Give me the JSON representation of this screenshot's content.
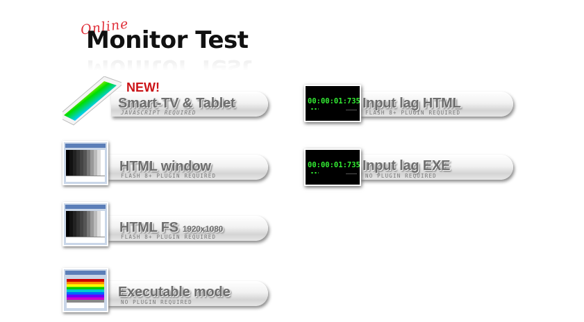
{
  "logo": {
    "online": "Online",
    "title": "Monitor Test"
  },
  "new_badge": "NEW!",
  "items": [
    {
      "id": "smart-tv",
      "label": "Smart-TV & Tablet",
      "sub": "JAVASCRIPT REQUIRED",
      "thumb": "tablet-rainbow"
    },
    {
      "id": "html-window",
      "label": "HTML window",
      "sub": "FLASH 8+ PLUGIN REQUIRED",
      "thumb": "grayscale-window"
    },
    {
      "id": "html-fs",
      "label": "HTML FS",
      "label_small": "1920x1080",
      "sub": "FLASH 8+ PLUGIN REQUIRED",
      "thumb": "grayscale-window"
    },
    {
      "id": "executable",
      "label": "Executable mode",
      "sub": "NO PLUGIN REQUIRED",
      "thumb": "rainbow-window"
    },
    {
      "id": "input-lag-html",
      "label": "Input lag HTML",
      "sub": "FLASH 8+ PLUGIN REQUIRED",
      "timer": "00:00:01:735"
    },
    {
      "id": "input-lag-exe",
      "label": "Input lag EXE",
      "sub": "NO PLUGIN REQUIRED",
      "timer": "00:00:01:735"
    }
  ],
  "colors": {
    "accent_red": "#cc1418",
    "timer_green": "#33ee33",
    "label_gray": "#6e6e6e"
  }
}
